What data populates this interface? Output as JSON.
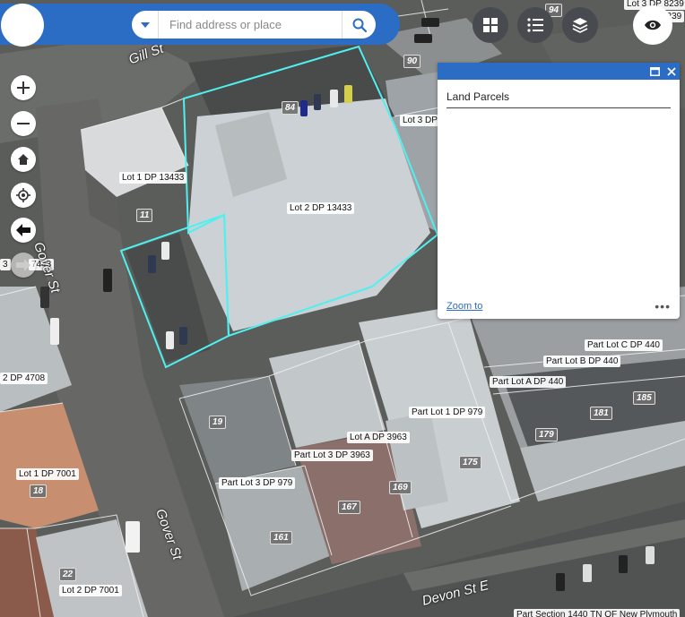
{
  "search": {
    "placeholder": "Find address or place"
  },
  "popup": {
    "title": "Land Parcels",
    "zoom_to": "Zoom to",
    "more": "•••"
  },
  "map": {
    "parcel_labels": [
      "Lot 1 DP 13433",
      "Lot 2 DP 13433",
      "Lot 3 DP",
      "Part Lot C DP 440",
      "Part Lot B DP 440",
      "Part Lot A DP 440",
      "Part Lot 1 DP 979",
      "Lot A DP 3963",
      "Part Lot 3 DP 3963",
      "Part Lot 3 DP 979",
      "Lot 1 DP 7001",
      "Lot 2 DP 7001",
      "2 DP 4708",
      "3",
      "7443",
      "Lot 3 DP 8239",
      "8239",
      "Part Section 1440 TN OF New Plymouth"
    ],
    "street_numbers": [
      "90",
      "94",
      "84",
      "11",
      "19",
      "18",
      "22",
      "185",
      "181",
      "179",
      "175",
      "169",
      "167",
      "161"
    ],
    "streets": [
      "Gill St",
      "Gover St",
      "Gover St",
      "Devon St E"
    ]
  },
  "colors": {
    "accent": "#2b6cc4",
    "parcel_highlight": "#4ff0f0"
  }
}
